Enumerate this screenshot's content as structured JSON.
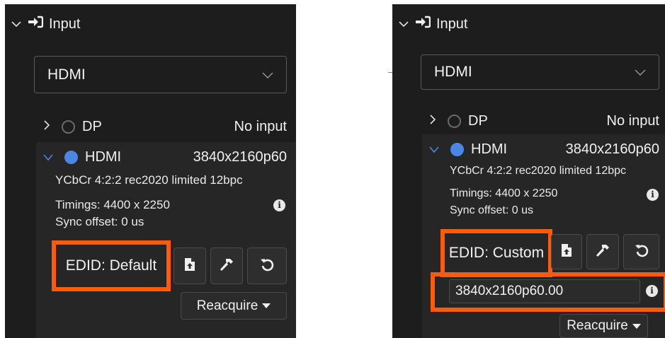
{
  "left": {
    "section_title": "Input",
    "dropdown": {
      "selected": "HDMI"
    },
    "sources": [
      {
        "name": "DP",
        "status": "No input",
        "expanded": false,
        "active": false
      },
      {
        "name": "HDMI",
        "status": "3840x2160p60",
        "expanded": true,
        "active": true
      }
    ],
    "details": {
      "color_format": "YCbCr 4:2:2 rec2020 limited 12bpc",
      "timings": "Timings: 4400 x 2250",
      "sync_offset": "Sync offset: 0 us"
    },
    "edid_label": "EDID: Default",
    "reacquire_label": "Reacquire"
  },
  "right": {
    "section_title": "Input",
    "dropdown": {
      "selected": "HDMI"
    },
    "sources": [
      {
        "name": "DP",
        "status": "No input",
        "expanded": false,
        "active": false
      },
      {
        "name": "HDMI",
        "status": "3840x2160p60",
        "expanded": true,
        "active": true
      }
    ],
    "details": {
      "color_format": "YCbCr 4:2:2 rec2020 limited 12bpc",
      "timings": "Timings: 4400 x 2250",
      "sync_offset": "Sync offset: 0 us"
    },
    "edid_label": "EDID: Custom",
    "custom_timing_value": "3840x2160p60.00",
    "reacquire_label": "Reacquire"
  },
  "icons": {
    "collapse": "chevron-down-icon",
    "expand": "chevron-right-icon",
    "input": "sign-in-icon",
    "info": "info-icon",
    "upload_file": "file-upload-icon",
    "tools": "hammer-icon",
    "reset": "undo-icon",
    "dropdown_arrow": "triangle-down-icon"
  },
  "colors": {
    "panel_bg": "#1d1d1d",
    "expanded_bg": "#262626",
    "active_radio": "#4a86e4",
    "highlight": "#ff5a0a"
  }
}
